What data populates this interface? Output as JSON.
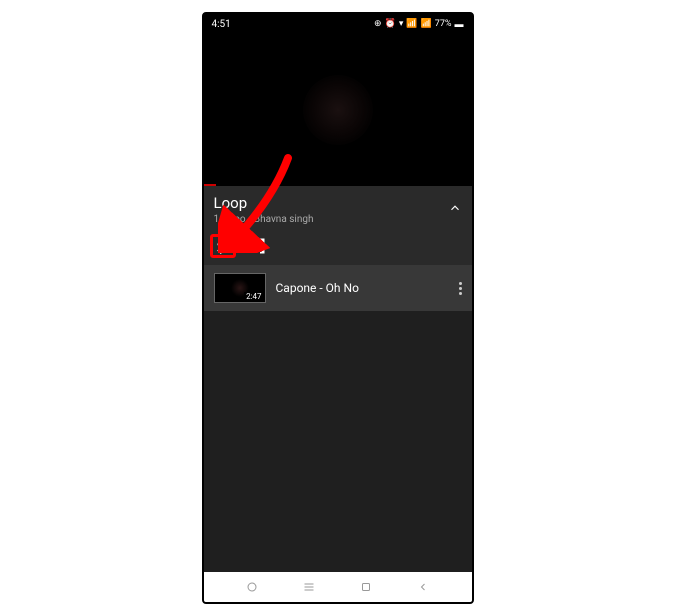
{
  "status": {
    "time": "4:51",
    "battery": "77%"
  },
  "playlist": {
    "title": "Loop",
    "subtitle": "1 video • Bhavna singh"
  },
  "track": {
    "duration": "2:47",
    "title": "Capone - Oh No"
  }
}
